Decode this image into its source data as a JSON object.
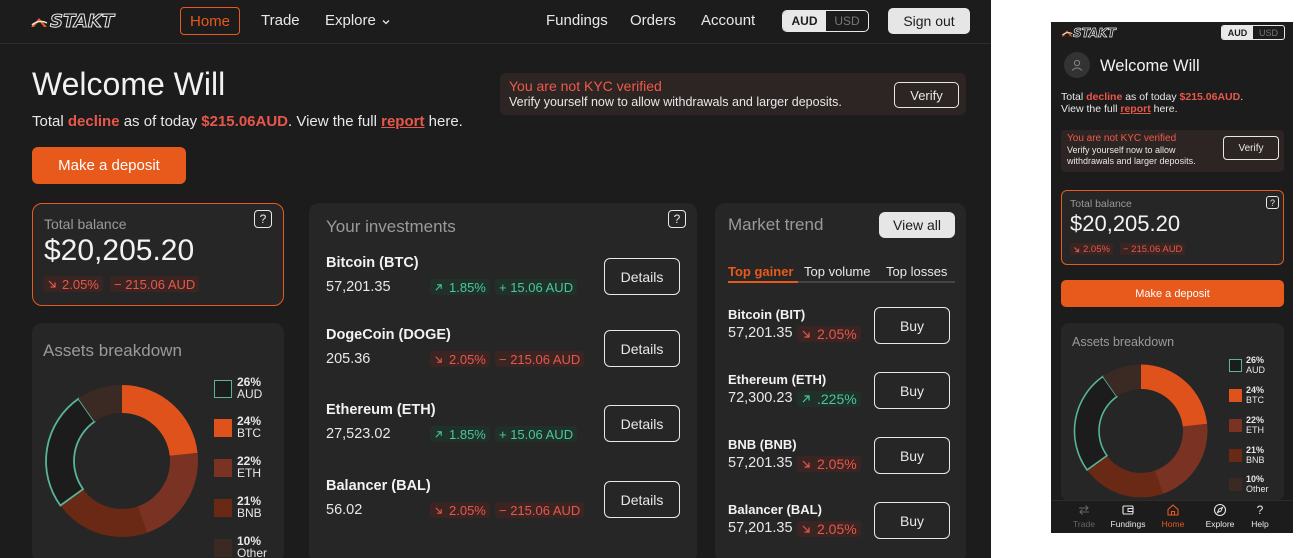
{
  "brand": {
    "name": "STAKT"
  },
  "nav": {
    "home": "Home",
    "trade": "Trade",
    "explore": "Explore",
    "fundings": "Fundings",
    "orders": "Orders",
    "account": "Account",
    "currency_on": "AUD",
    "currency_off": "USD",
    "signout": "Sign out"
  },
  "welcome": {
    "title": "Welcome Will",
    "prefix": "Total",
    "trend_word": "decline",
    "mid": "as of today",
    "amount": "$215.06AUD",
    "tail": ". View the full",
    "link": "report",
    "end": "here."
  },
  "deposit_label": "Make a deposit",
  "kyc": {
    "title": "You are not KYC verified",
    "description": "Verify yourself now to allow withdrawals and larger deposits.",
    "button": "Verify"
  },
  "total_balance": {
    "label": "Total balance",
    "value": "$20,205.20",
    "pct": "2.05%",
    "change": "− 215.06 AUD",
    "help": "?"
  },
  "assets": {
    "title": "Assets breakdown",
    "items": [
      {
        "pct": "26%",
        "name": "AUD",
        "pct_value": 26,
        "color": "#1c1c1c",
        "stroke": "#58b59a"
      },
      {
        "pct": "24%",
        "name": "BTC",
        "pct_value": 24,
        "color": "#e0521c"
      },
      {
        "pct": "22%",
        "name": "ETH",
        "pct_value": 22,
        "color": "#7a3322"
      },
      {
        "pct": "21%",
        "name": "BNB",
        "pct_value": 21,
        "color": "#6a2914"
      },
      {
        "pct": "10%",
        "name": "Other",
        "pct_value": 10,
        "color": "#3b2924"
      }
    ]
  },
  "investments": {
    "title": "Your investments",
    "help": "?",
    "details_label": "Details",
    "rows": [
      {
        "name": "Bitcoin (BTC)",
        "price": "57,201.35",
        "pct": "1.85%",
        "change": "+ 15.06 AUD",
        "direction": "up"
      },
      {
        "name": "DogeCoin (DOGE)",
        "price": "205.36",
        "pct": "2.05%",
        "change": "− 215.06 AUD",
        "direction": "down"
      },
      {
        "name": "Ethereum (ETH)",
        "price": "27,523.02",
        "pct": "1.85%",
        "change": "+ 15.06 AUD",
        "direction": "up"
      },
      {
        "name": "Balancer (BAL)",
        "price": "56.02",
        "pct": "2.05%",
        "change": "− 215.06 AUD",
        "direction": "down"
      }
    ]
  },
  "market": {
    "title": "Market trend",
    "view_all": "View all",
    "tabs": [
      "Top gainer",
      "Top volume",
      "Top losses"
    ],
    "buy_label": "Buy",
    "rows": [
      {
        "name": "Bitcoin (BIT)",
        "price": "57,201.35",
        "pct": "2.05%",
        "direction": "down"
      },
      {
        "name": "Ethereum (ETH)",
        "price": "72,300.23",
        "pct": ".225%",
        "direction": "up"
      },
      {
        "name": "BNB (BNB)",
        "price": "57,201.35",
        "pct": "2.05%",
        "direction": "down"
      },
      {
        "name": "Balancer (BAL)",
        "price": "57,201.35",
        "pct": "2.05%",
        "direction": "down"
      }
    ]
  },
  "mobile": {
    "summary_line2_prefix": "View the full",
    "kyc_desc": "Verify yourself now to allow withdrawals and  larger deposits.",
    "bottom_nav": [
      "Trade",
      "Fundings",
      "Home",
      "Explore",
      "Help"
    ]
  },
  "colors": {
    "accent": "#e8591c",
    "negative": "#e8574b",
    "positive": "#4cc79a",
    "background": "#1c1c1c",
    "card": "#262626"
  }
}
